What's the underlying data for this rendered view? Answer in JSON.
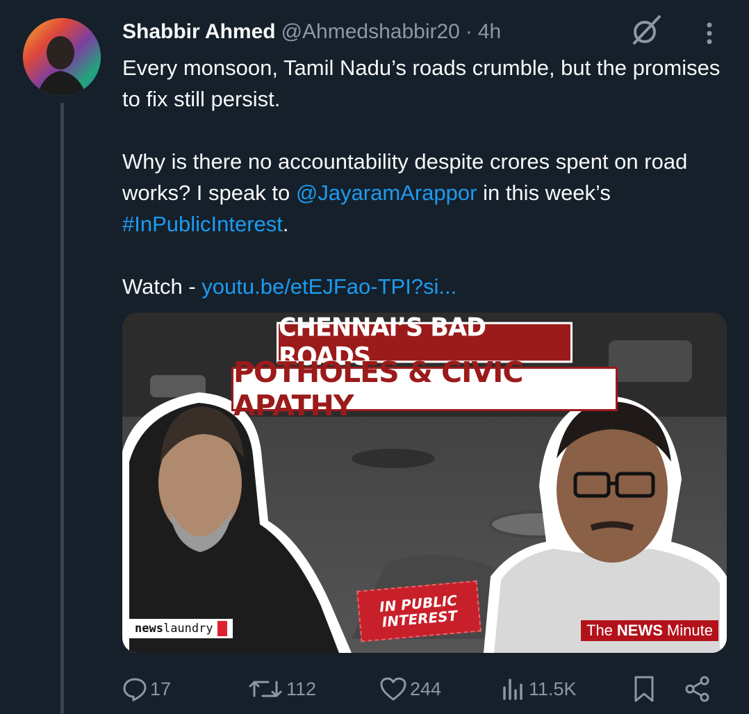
{
  "author": {
    "name": "Shabbir Ahmed",
    "handle": "@Ahmedshabbir20",
    "separator": "·",
    "time": "4h"
  },
  "tweet": {
    "line1": "Every monsoon, Tamil Nadu’s roads crumble, but the promises to fix still persist.",
    "line2_before": "Why is there no accountability despite crores spent on road works? I speak to ",
    "mention": "@JayaramArappor",
    "line2_after": " in this week’s ",
    "hashtag": "#InPublicInterest",
    "line2_end": ".",
    "watch_label": "Watch - ",
    "watch_link": "youtu.be/etEJFao-TPI?si..."
  },
  "media": {
    "title_top": "CHENNAI’S BAD ROADS",
    "title_bottom": "POTHOLES & CIVIC APATHY",
    "badge_line1": "IN PUBLIC",
    "badge_line2": "INTEREST",
    "logo_left_bold": "news",
    "logo_left_rest": "laundry",
    "logo_right_pre": "The",
    "logo_right_bold": "NEWS",
    "logo_right_post": "Minute"
  },
  "actions": {
    "replies": "17",
    "reposts": "112",
    "likes": "244",
    "views": "11.5K"
  },
  "colors": {
    "background": "#15202b",
    "accent": "#1d9bf0",
    "muted": "#8b98a5"
  }
}
